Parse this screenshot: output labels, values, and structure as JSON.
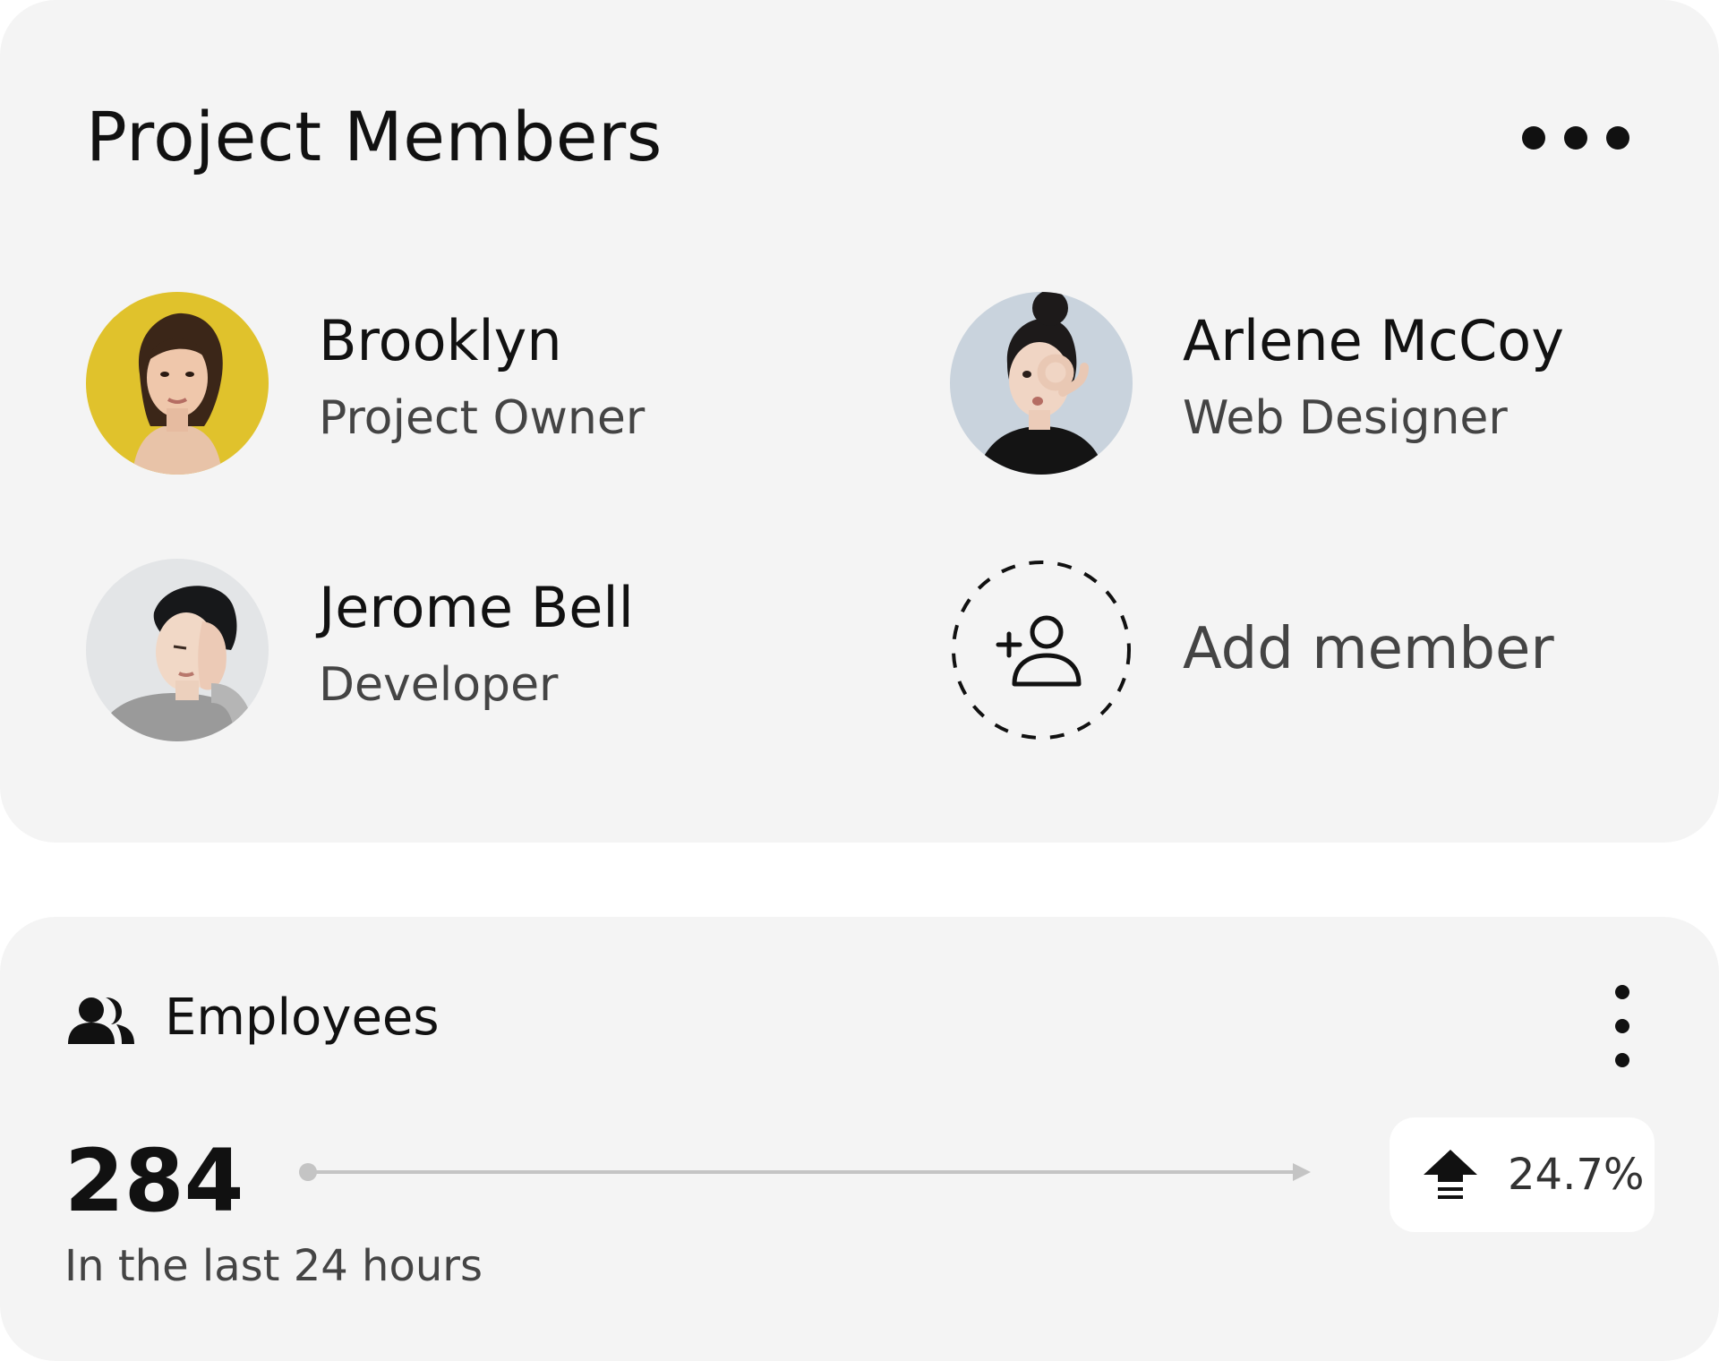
{
  "members_card": {
    "title": "Project Members",
    "menu_icon": "more-horizontal-icon",
    "members": [
      {
        "name": "Brooklyn",
        "role": "Project Owner",
        "avatar_bg": "#e0c22c"
      },
      {
        "name": "Arlene McCoy",
        "role": "Web Designer",
        "avatar_bg": "#c9d3dd"
      },
      {
        "name": "Jerome Bell",
        "role": "Developer",
        "avatar_bg": "#e3e5e7"
      }
    ],
    "add_member": {
      "label": "Add member",
      "icon": "add-user-icon"
    }
  },
  "employees_card": {
    "title": "Employees",
    "icon": "users-icon",
    "menu_icon": "more-vertical-icon",
    "count": "284",
    "subtitle": "In the last 24 hours",
    "change": {
      "value": "24.7%",
      "direction": "up",
      "icon": "arrow-up-icon"
    }
  },
  "colors": {
    "card_bg": "#f4f4f4",
    "page_bg": "#ffffff",
    "text_primary": "#111111",
    "text_secondary": "#444444",
    "line": "#c4c4c4"
  }
}
